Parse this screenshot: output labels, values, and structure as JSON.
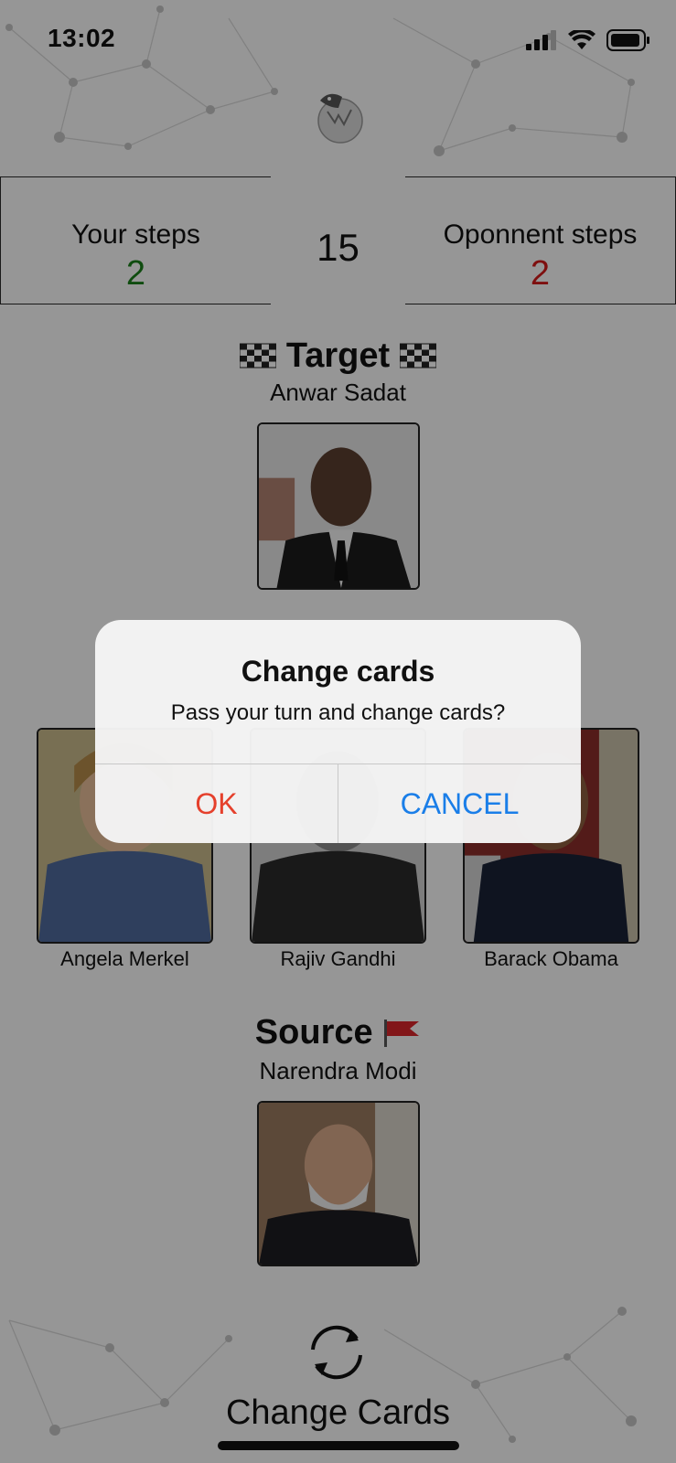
{
  "status_bar": {
    "time": "13:02"
  },
  "scoreboard": {
    "your_steps_label": "Your steps",
    "your_steps_value": "2",
    "total_steps": "15",
    "opponent_steps_label": "Oponnent steps",
    "opponent_steps_value": "2"
  },
  "target": {
    "title": "Target",
    "name": "Anwar Sadat"
  },
  "options": [
    {
      "name": "Angela Merkel"
    },
    {
      "name": "Rajiv Gandhi"
    },
    {
      "name": "Barack Obama"
    }
  ],
  "source": {
    "title": "Source",
    "name": "Narendra Modi"
  },
  "footer": {
    "change_cards_label": "Change Cards"
  },
  "dialog": {
    "title": "Change cards",
    "message": "Pass your turn and change cards?",
    "ok_label": "OK",
    "cancel_label": "CANCEL"
  },
  "colors": {
    "your_steps": "#1a7f1a",
    "opponent_steps": "#d21a1a",
    "ok": "#e5402c",
    "cancel": "#1a7ee8"
  }
}
